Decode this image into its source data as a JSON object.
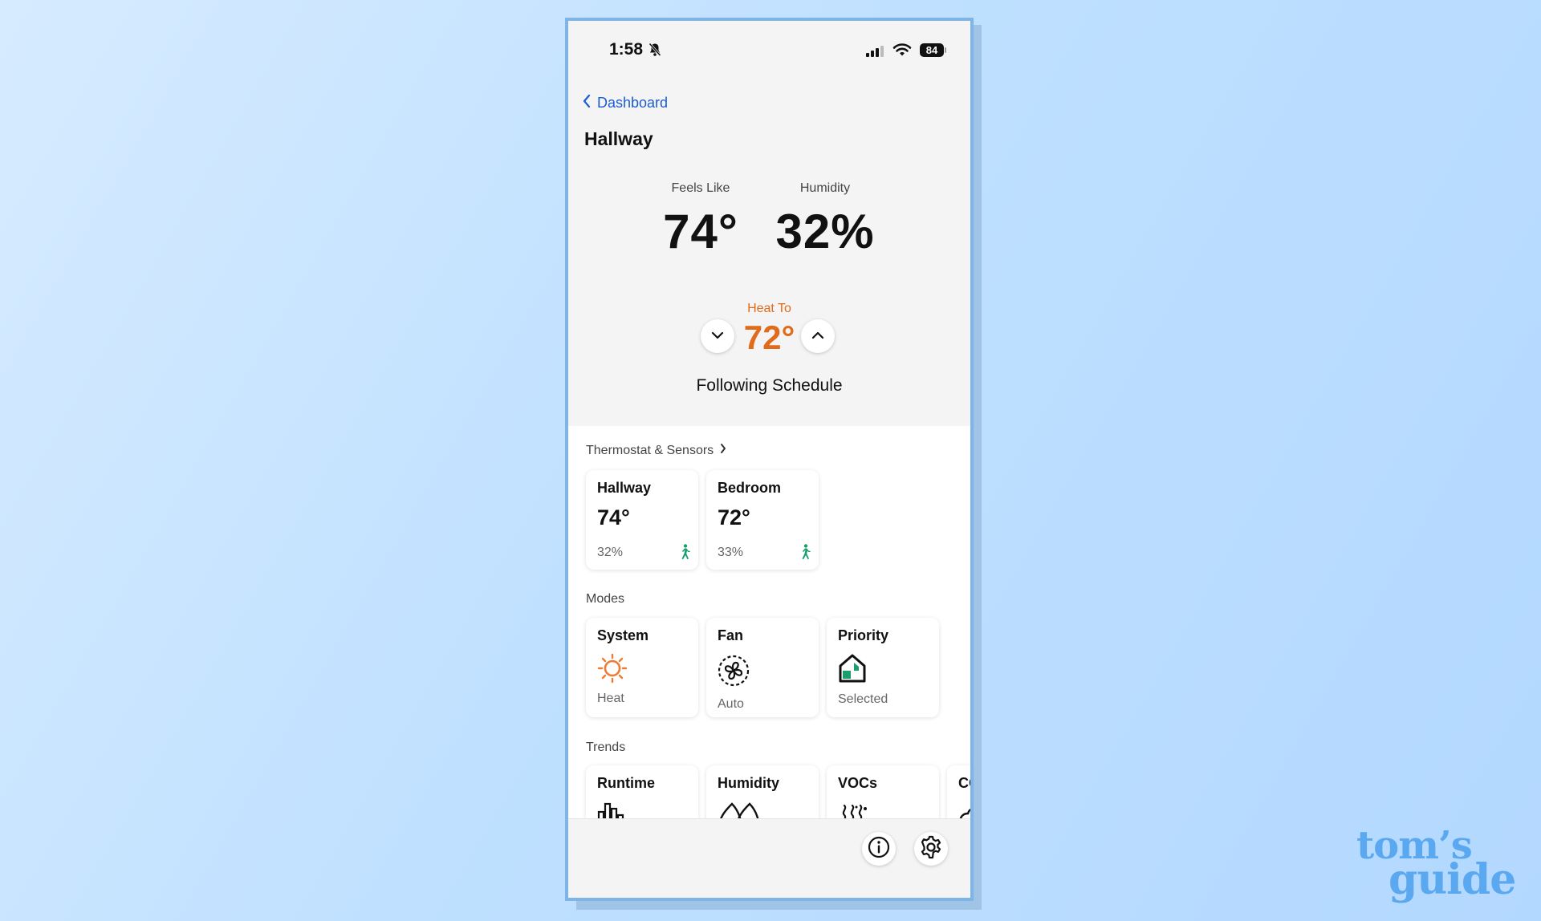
{
  "status_bar": {
    "time": "1:58",
    "battery": "84"
  },
  "nav": {
    "back_label": "Dashboard"
  },
  "page": {
    "title": "Hallway"
  },
  "conditions": {
    "feels_like_label": "Feels Like",
    "feels_like_value": "74°",
    "humidity_label": "Humidity",
    "humidity_value": "32%"
  },
  "setpoint": {
    "label": "Heat To",
    "value": "72°",
    "schedule_status": "Following Schedule"
  },
  "sensors": {
    "section_label": "Thermostat & Sensors",
    "items": [
      {
        "name": "Hallway",
        "temp": "74°",
        "humidity": "32%"
      },
      {
        "name": "Bedroom",
        "temp": "72°",
        "humidity": "33%"
      }
    ]
  },
  "modes": {
    "section_label": "Modes",
    "items": [
      {
        "title": "System",
        "value": "Heat",
        "icon": "sun-icon"
      },
      {
        "title": "Fan",
        "value": "Auto",
        "icon": "fan-icon"
      },
      {
        "title": "Priority",
        "value": "Selected",
        "icon": "house-icon"
      }
    ]
  },
  "trends": {
    "section_label": "Trends",
    "items": [
      {
        "title": "Runtime",
        "icon": "bar-chart-icon"
      },
      {
        "title": "Humidity",
        "icon": "droplets-icon"
      },
      {
        "title": "VOCs",
        "icon": "vapor-icon"
      },
      {
        "title": "CO",
        "icon": "cloud-icon"
      }
    ]
  },
  "colors": {
    "accent": "#e06b1a",
    "link": "#1a5bd6",
    "occupancy": "#1a9e6b"
  },
  "watermark": {
    "line1": "tom’s",
    "line2": "guide"
  }
}
